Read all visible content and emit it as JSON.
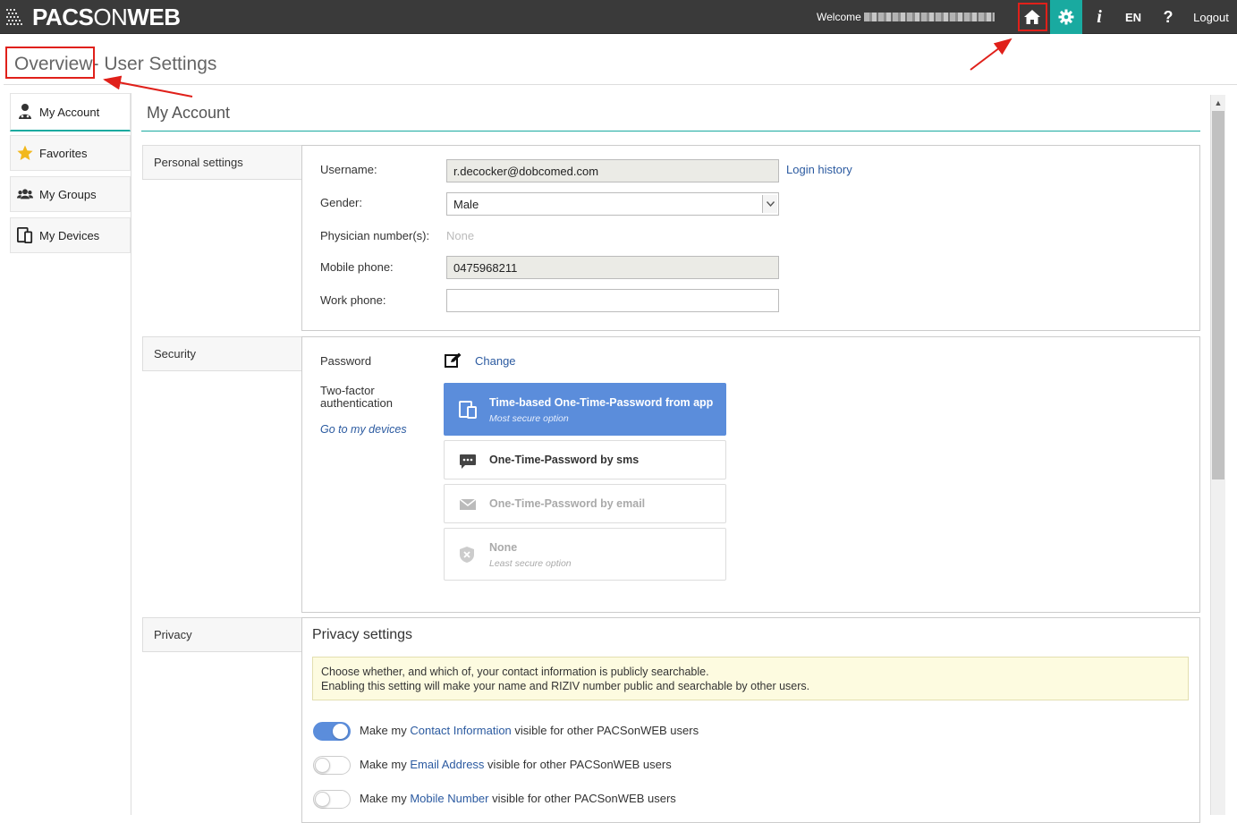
{
  "topbar": {
    "logo_text_bold1": "PACS",
    "logo_text_light": "ON",
    "logo_text_bold2": "WEB",
    "welcome_label": "Welcome",
    "lang_label": "EN",
    "info_label": "i",
    "help_label": "?",
    "logout_label": "Logout",
    "accent": "#19aaa0"
  },
  "header": {
    "title_part1": "Overview",
    "title_part2": " - User Settings"
  },
  "sidebar": {
    "items": [
      {
        "label": "My Account",
        "icon": "user-icon",
        "active": true
      },
      {
        "label": "Favorites",
        "icon": "star-icon",
        "active": false
      },
      {
        "label": "My Groups",
        "icon": "group-icon",
        "active": false
      },
      {
        "label": "My Devices",
        "icon": "devices-icon",
        "active": false
      }
    ]
  },
  "main": {
    "title": "My Account",
    "personal": {
      "section_label": "Personal settings",
      "username_label": "Username:",
      "username_value": "r.decocker@dobcomed.com",
      "login_history_label": "Login history",
      "gender_label": "Gender:",
      "gender_value": "Male",
      "physician_label": "Physician number(s):",
      "physician_value": "None",
      "mobile_label": "Mobile phone:",
      "mobile_value": "0475968211",
      "work_label": "Work phone:",
      "work_value": ""
    },
    "security": {
      "section_label": "Security",
      "password_label": "Password",
      "change_label": "Change",
      "twofactor_label_line1": "Two-factor",
      "twofactor_label_line2": "authentication",
      "go_devices_label": "Go to my devices",
      "options": [
        {
          "title": "Time-based One-Time-Password from app",
          "subtitle": "Most secure option",
          "icon": "device-icon",
          "selected": true,
          "disabled": false
        },
        {
          "title": "One-Time-Password by sms",
          "subtitle": "",
          "icon": "chat-icon",
          "selected": false,
          "disabled": false
        },
        {
          "title": "One-Time-Password by email",
          "subtitle": "",
          "icon": "mail-icon",
          "selected": false,
          "disabled": true
        },
        {
          "title": "None",
          "subtitle": "Least secure option",
          "icon": "shield-x-icon",
          "selected": false,
          "disabled": true
        }
      ]
    },
    "privacy": {
      "section_label": "Privacy",
      "title": "Privacy settings",
      "note_line1": "Choose whether, and which of, your contact information is publicly searchable.",
      "note_line2": "Enabling this setting will make your name and RIZIV number public and searchable by other users.",
      "toggles": [
        {
          "prefix": "Make my ",
          "link": "Contact Information",
          "suffix": " visible for other PACSonWEB users",
          "on": true
        },
        {
          "prefix": "Make my ",
          "link": "Email Address",
          "suffix": " visible for other PACSonWEB users",
          "on": false
        },
        {
          "prefix": "Make my ",
          "link": "Mobile Number",
          "suffix": " visible for other PACSonWEB users",
          "on": false
        }
      ]
    }
  }
}
